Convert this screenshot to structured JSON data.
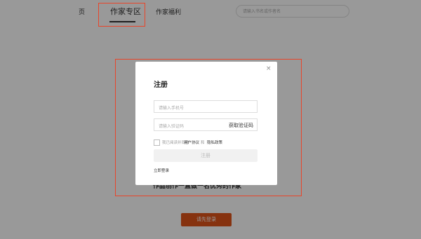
{
  "nav": {
    "home_label": "页",
    "author_zone_label": "作家专区",
    "author_welfare_label": "作家福利",
    "search_placeholder": "请输入书名或作者名"
  },
  "background": {
    "partial_text": "作品创作一直做一名优秀的作家",
    "login_button_label": "请先登录"
  },
  "modal": {
    "close_symbol": "×",
    "title": "注册",
    "phone_placeholder": "请输入手机号",
    "code_placeholder": "请输入验证码",
    "get_code_label": "获取验证码",
    "agree_prefix": "我已阅读并同意",
    "user_agreement": "用户协议",
    "and": "和",
    "privacy_policy": "隐私政策",
    "register_label": "注册",
    "login_now": "立即登录"
  },
  "colors": {
    "accent": "#e0541a",
    "annotation": "#e8452a"
  }
}
